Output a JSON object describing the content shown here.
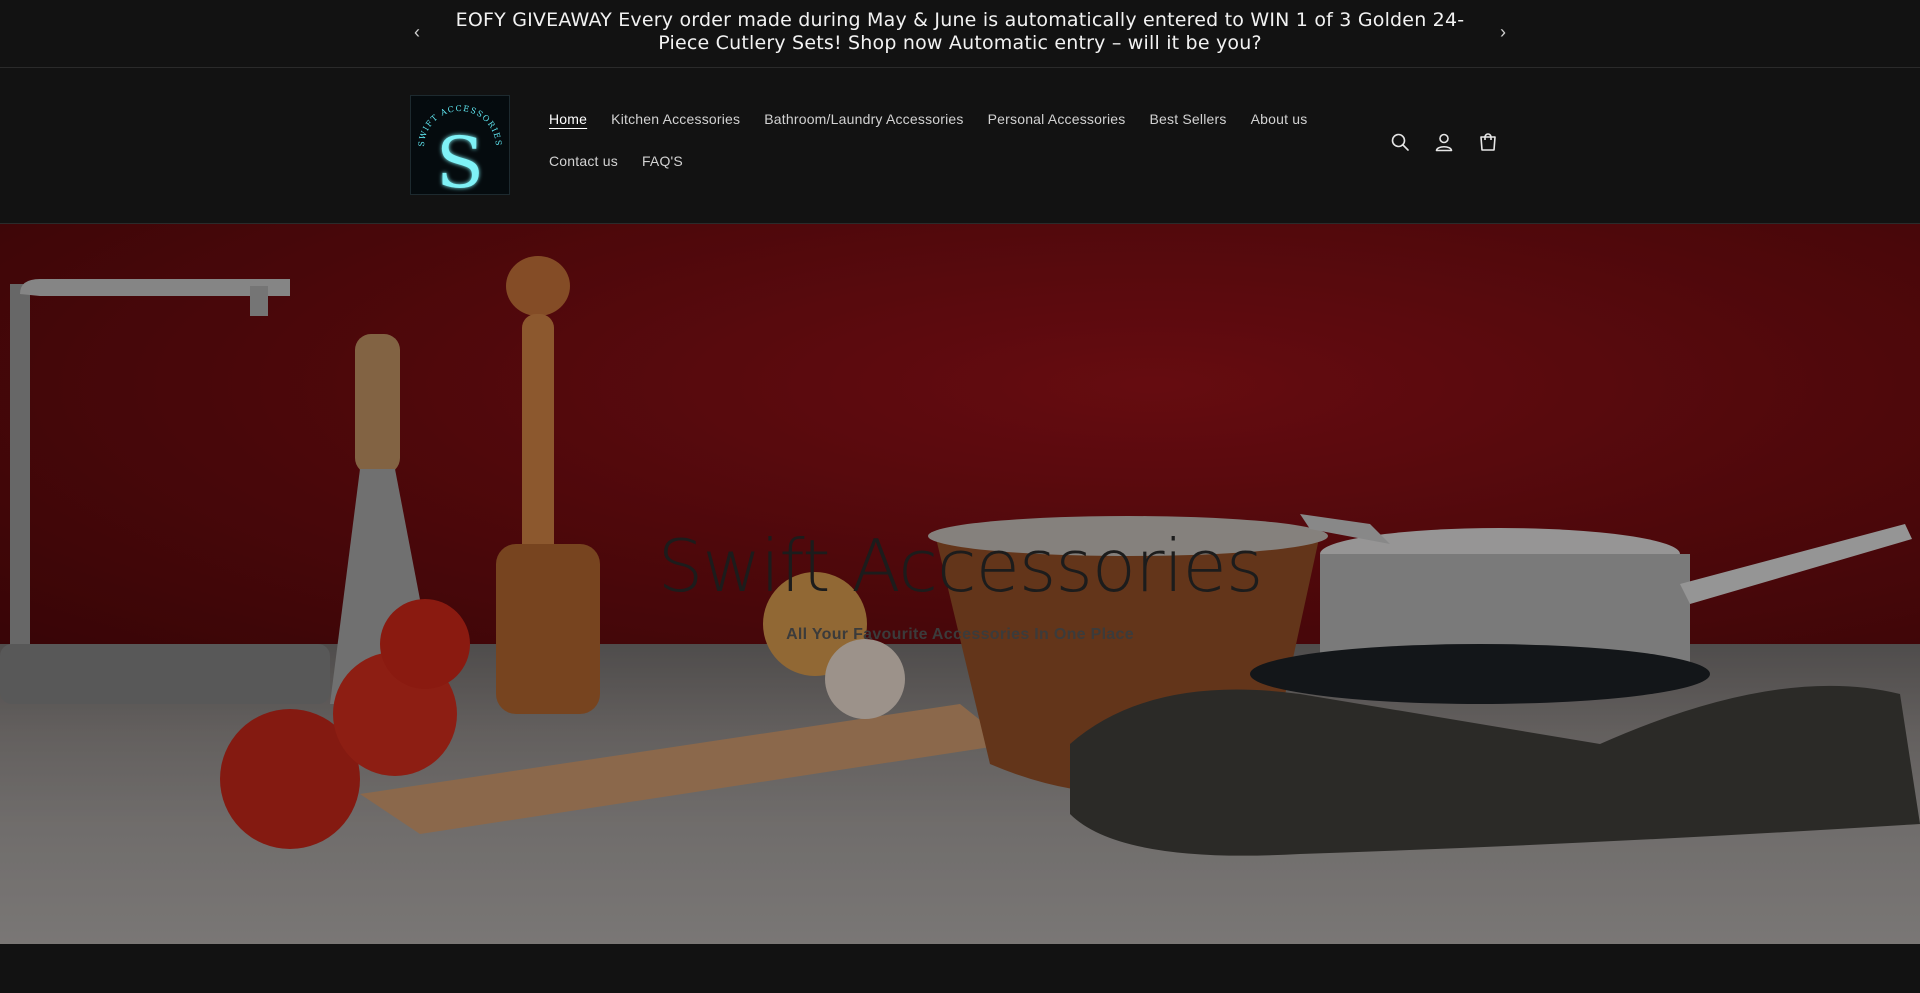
{
  "announcement": {
    "text": "EOFY GIVEAWAY    Every order made during May & June is automatically entered to WIN    1 of 3 Golden 24-Piece Cutlery Sets! Shop now    Automatic entry – will it be you?",
    "prev_icon": "chevron-left-icon",
    "next_icon": "chevron-right-icon"
  },
  "header": {
    "logo": {
      "text": "SWIFT ACCESSORIES",
      "letter": "S",
      "color": "#5fe6f0"
    },
    "nav": {
      "row1": [
        "Home",
        "Kitchen Accessories",
        "Bathroom/Laundry Accessories",
        "Personal Accessories",
        "Best Sellers",
        "About us"
      ],
      "row2": [
        "Contact us",
        "FAQ'S"
      ],
      "active": "Home"
    },
    "icons": [
      "search-icon",
      "account-icon",
      "cart-icon"
    ]
  },
  "hero": {
    "title": "Swift Accessories",
    "subtitle": "All Your Favourite Accessories In One Place"
  },
  "colors": {
    "background": "#121212",
    "wall_red": "#8d1117",
    "text_light": "#e6e6e6"
  }
}
